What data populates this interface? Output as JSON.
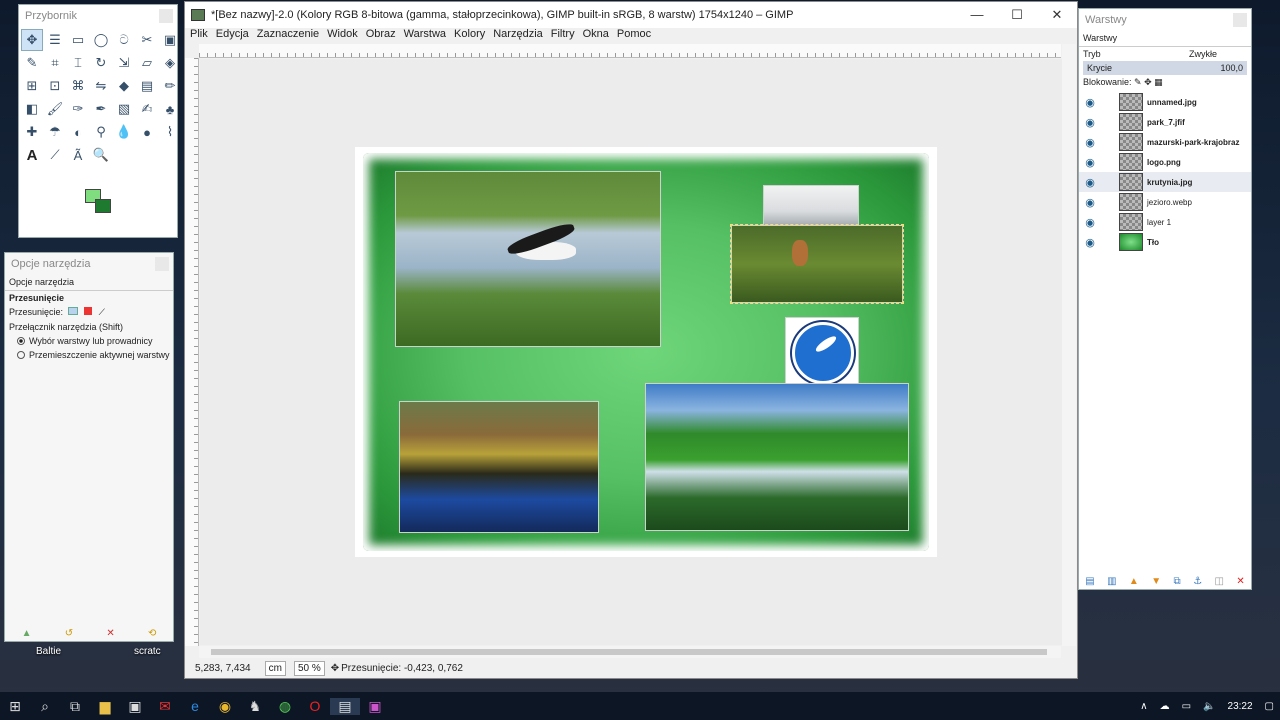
{
  "toolbox": {
    "title": "Przybornik"
  },
  "tool_options": {
    "title": "Opcje narzędzia",
    "tab": "Opcje narzędzia",
    "section": "Przesunięcie",
    "move_label": "Przesunięcie:",
    "switch_label": "Przełącznik narzędzia  (Shift)",
    "radio1": "Wybór warstwy lub prowadnicy",
    "radio2": "Przemieszczenie aktywnej warstwy"
  },
  "main": {
    "title": "*[Bez nazwy]-2.0 (Kolory RGB 8-bitowa (gamma, stałoprzecinkowa), GIMP built-in sRGB, 8 warstw) 1754x1240 – GIMP",
    "menu": [
      "Plik",
      "Edycja",
      "Zaznaczenie",
      "Widok",
      "Obraz",
      "Warstwa",
      "Kolory",
      "Narzędzia",
      "Filtry",
      "Okna",
      "Pomoc"
    ],
    "status": {
      "coords": "5,283, 7,434",
      "unit": "cm",
      "zoom": "50 %",
      "message": "Przesunięcie: -0,423, 0,762"
    }
  },
  "layers_panel": {
    "title": "Warstwy",
    "tab": "Warstwy",
    "mode_label": "Tryb",
    "mode_value": "Zwykłe",
    "opacity_label": "Krycie",
    "opacity_value": "100,0",
    "lock_label": "Blokowanie:",
    "layers": [
      {
        "name": "unnamed.jpg"
      },
      {
        "name": "park_7.jfif"
      },
      {
        "name": "mazurski-park-krajobraz"
      },
      {
        "name": "logo.png"
      },
      {
        "name": "krutynia.jpg"
      },
      {
        "name": "jezioro.webp"
      },
      {
        "name": "layer 1"
      },
      {
        "name": "Tło"
      }
    ]
  },
  "desktop": {
    "label1": "Baltie",
    "label2": "scratc"
  },
  "taskbar": {
    "time": "23:22"
  }
}
